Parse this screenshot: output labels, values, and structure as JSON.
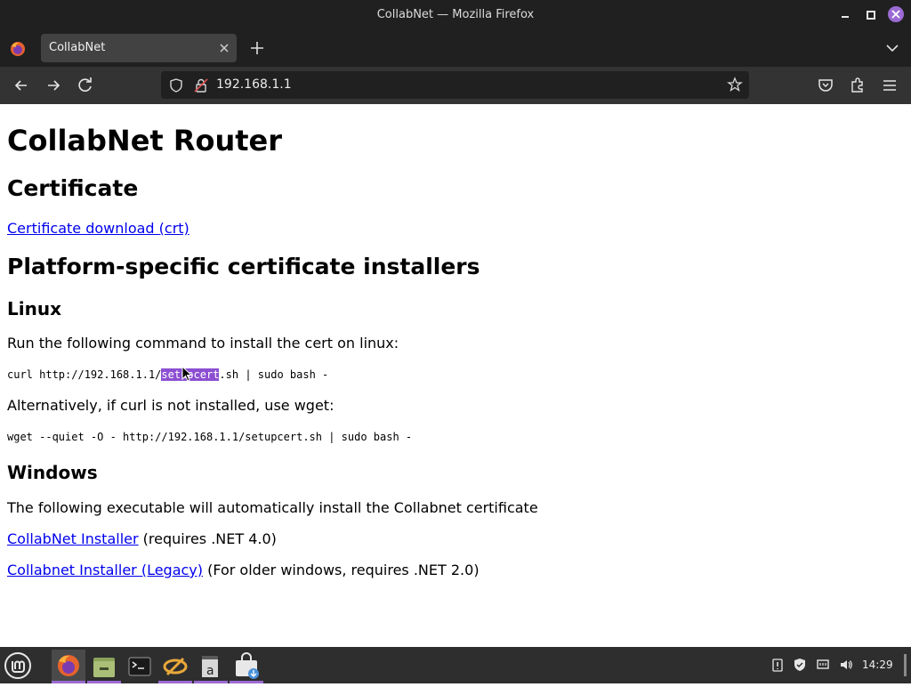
{
  "window": {
    "title": "CollabNet — Mozilla Firefox"
  },
  "browser": {
    "tab_label": "CollabNet",
    "url": "192.168.1.1",
    "accent_color": "#9b6bd3"
  },
  "page": {
    "h1": "CollabNet Router",
    "cert_heading": "Certificate",
    "cert_link": "Certificate download (crt)",
    "platform_heading": "Platform-specific certificate installers",
    "linux_heading": "Linux",
    "linux_intro": "Run the following command to install the cert on linux:",
    "curl_cmd_pre": "curl http://192.168.1.1/",
    "curl_cmd_sel": "setupcert",
    "curl_cmd_post": ".sh | sudo bash -",
    "wget_intro": "Alternatively, if curl is not installed, use wget:",
    "wget_cmd": "wget --quiet -O - http://192.168.1.1/setupcert.sh | sudo bash -",
    "windows_heading": "Windows",
    "windows_intro": "The following executable will automatically install the Collabnet certificate",
    "installer_link": "CollabNet Installer",
    "installer_note": " (requires .NET 4.0)",
    "legacy_link": "Collabnet Installer (Legacy)",
    "legacy_note": " (For older windows, requires .NET 2.0)"
  },
  "taskbar": {
    "clock": "14:29",
    "apps": [
      "firefox-icon",
      "files-icon",
      "terminal-icon",
      "network-icon",
      "text-editor-icon",
      "software-store-icon"
    ]
  }
}
